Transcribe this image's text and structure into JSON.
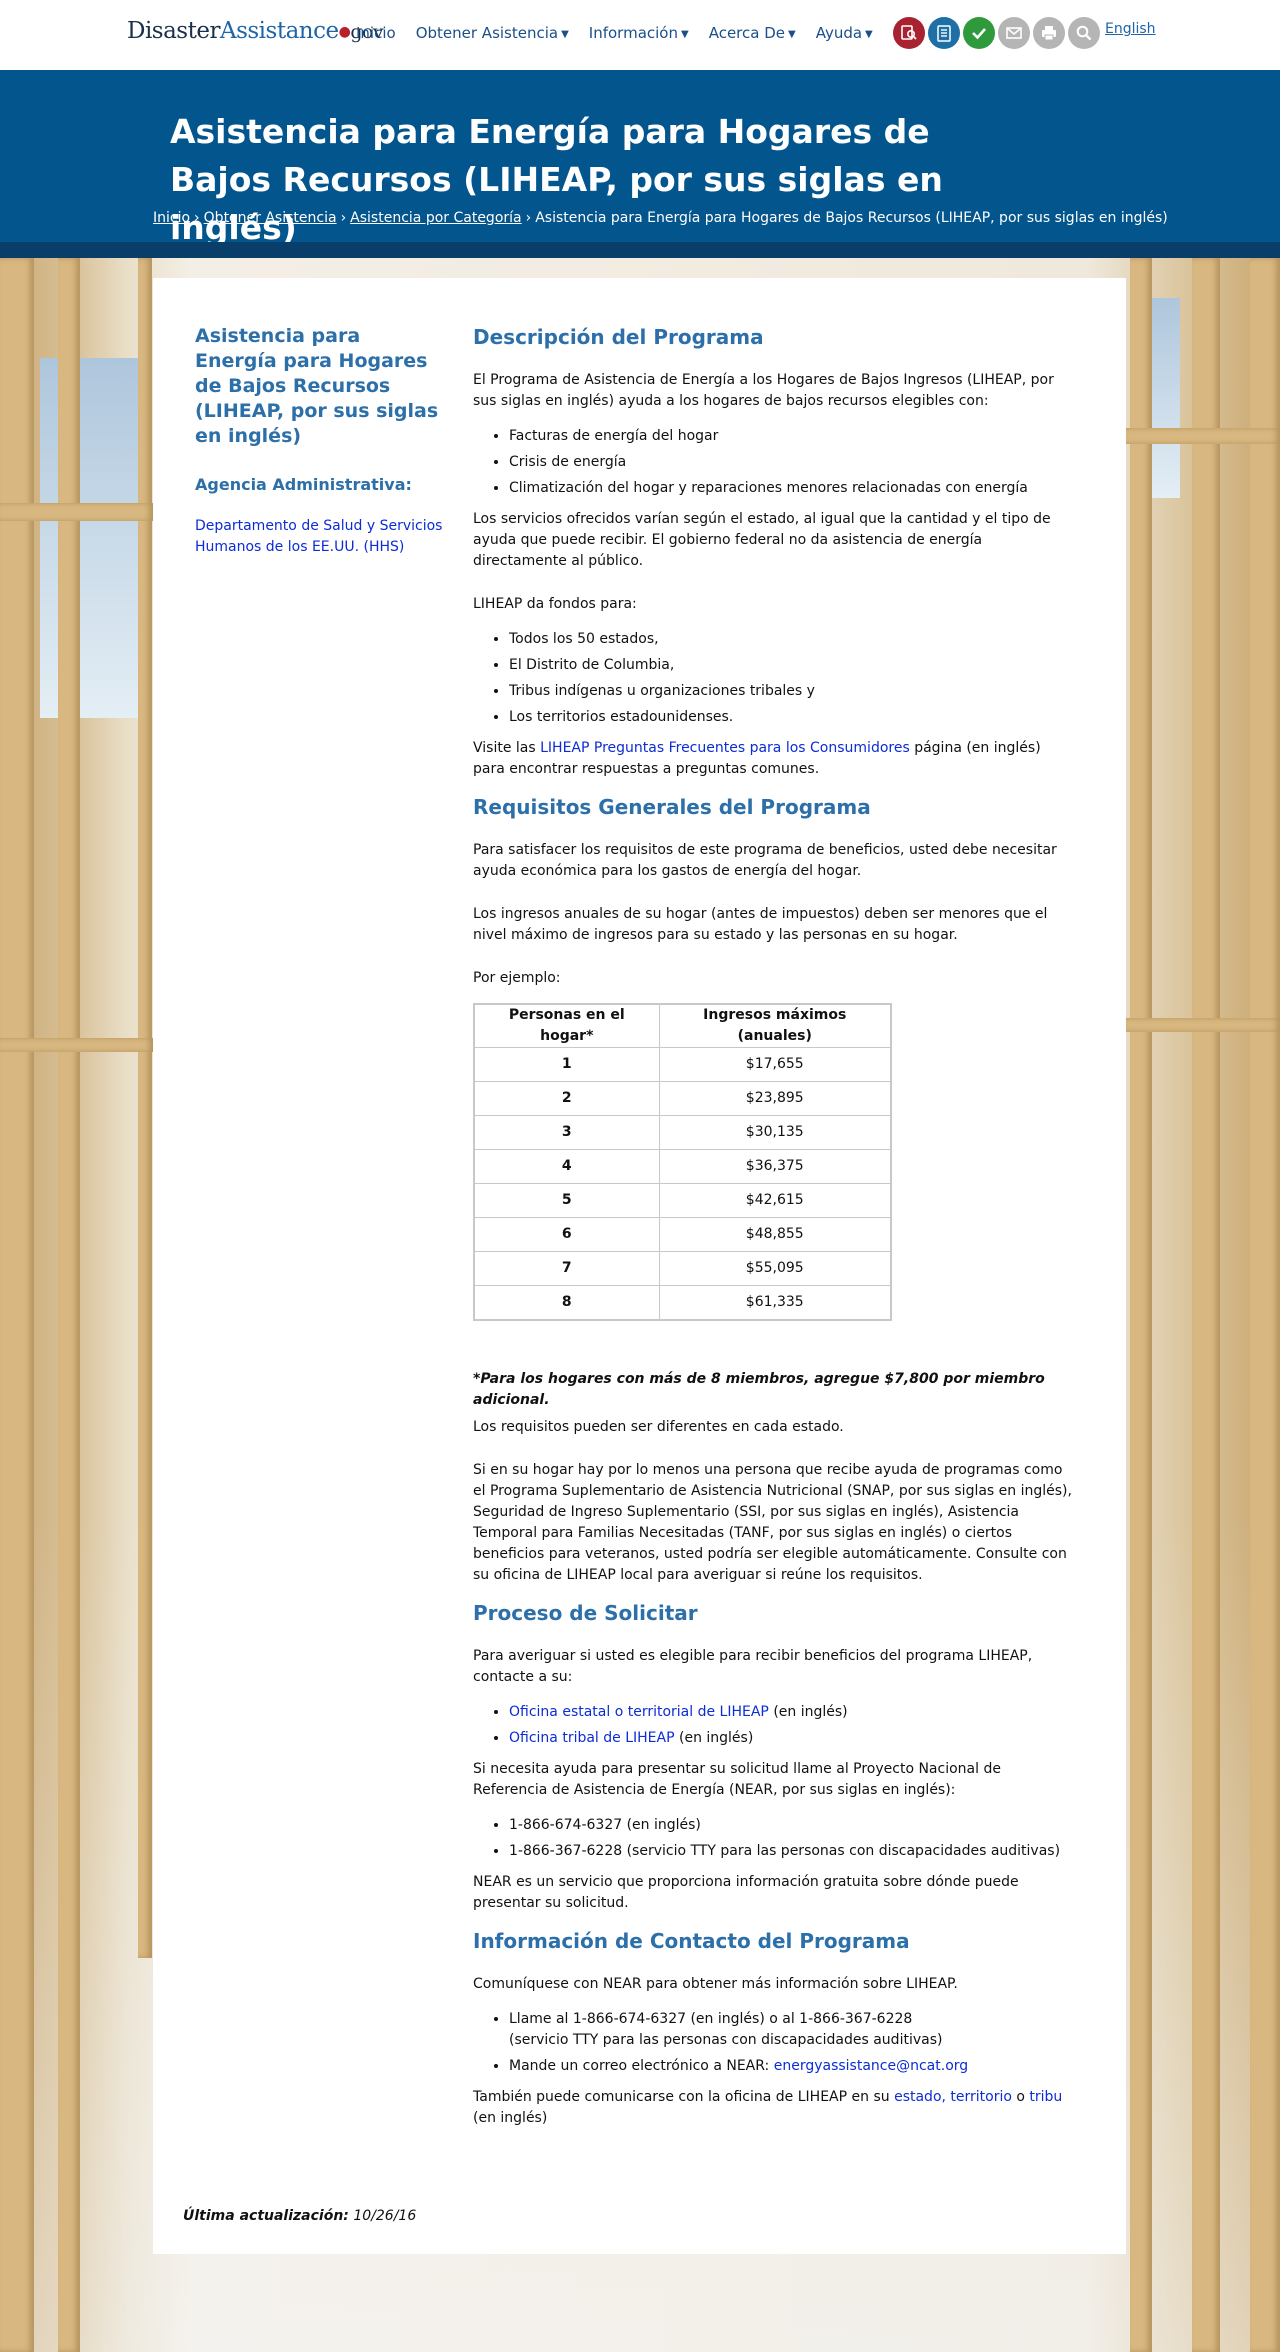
{
  "header": {
    "logo": {
      "brand_dark": "Disaster",
      "brand_blue": "Assistance",
      "dot": "●",
      "tld": "gov"
    },
    "nav": [
      {
        "label": "Inicio",
        "has_menu": false
      },
      {
        "label": "Obtener Asistencia",
        "has_menu": true
      },
      {
        "label": "Información",
        "has_menu": true
      },
      {
        "label": "Acerca De",
        "has_menu": true
      },
      {
        "label": "Ayuda",
        "has_menu": true
      }
    ],
    "tools": [
      {
        "icon": "search-document-icon",
        "color": "#a8232f"
      },
      {
        "icon": "checklist-icon",
        "color": "#1d6fa5"
      },
      {
        "icon": "checkmark-icon",
        "color": "#2f9a3c"
      },
      {
        "icon": "email-icon",
        "color": "#b5b5b5"
      },
      {
        "icon": "print-icon",
        "color": "#b5b5b5"
      },
      {
        "icon": "magnifier-icon",
        "color": "#b5b5b5"
      }
    ],
    "language_link": "English"
  },
  "banner": {
    "title": "Asistencia para Energía para Hogares de Bajos Recursos (LIHEAP, por sus siglas en inglés)",
    "breadcrumb": {
      "items": [
        "Inicio",
        "Obtener Asistencia",
        "Asistencia por Categoría"
      ],
      "separator": "›",
      "current": "Asistencia para Energía para Hogares de Bajos Recursos (LIHEAP, por sus siglas en inglés)"
    },
    "color": "#03558d"
  },
  "sidebar": {
    "title": "Asistencia para Energía para Hogares de Bajos Recursos (LIHEAP, por sus siglas en inglés)",
    "agency_label": "Agencia Administrativa:",
    "agency_link": "Departamento de Salud y Servicios Humanos de los EE.UU. (HHS)"
  },
  "main": {
    "description": {
      "heading": "Descripción del Programa",
      "intro": "El Programa de Asistencia de Energía a los Hogares de Bajos Ingresos (LIHEAP, por sus siglas en inglés) ayuda a los hogares de bajos recursos elegibles con:",
      "items": [
        "Facturas de energía del hogar",
        "Crisis de energía",
        "Climatización del hogar y reparaciones menores relacionadas con energía"
      ],
      "services": "Los servicios ofrecidos varían según el estado, al igual que la cantidad y el tipo de ayuda que puede recibir. El gobierno federal no da asistencia de energía directamente al público.",
      "funds_label": "LIHEAP da fondos para:",
      "funds": [
        "Todos los 50 estados,",
        "El Distrito de Columbia,",
        "Tribus indígenas u organizaciones tribales y",
        "Los territorios estadounidenses."
      ],
      "faq_prefix": "Visite las ",
      "faq_link": "LIHEAP Preguntas Frecuentes para los Consumidores",
      "faq_suffix": " página (en inglés) para encontrar respuestas a preguntas comunes."
    },
    "requirements": {
      "heading": "Requisitos Generales del Programa",
      "p1": "Para satisfacer los requisitos de este programa de beneficios, usted debe necesitar ayuda económica para los gastos de energía del hogar.",
      "p2": "Los ingresos anuales de su hogar (antes de impuestos) deben ser menores que el nivel máximo de ingresos para su estado y las personas en su hogar.",
      "example_label": "Por ejemplo:",
      "table": {
        "headers": [
          "Personas en el hogar*",
          "Ingresos máximos (anuales)"
        ],
        "rows": [
          [
            "1",
            "$17,655"
          ],
          [
            "2",
            "$23,895"
          ],
          [
            "3",
            "$30,135"
          ],
          [
            "4",
            "$36,375"
          ],
          [
            "5",
            "$42,615"
          ],
          [
            "6",
            "$48,855"
          ],
          [
            "7",
            "$55,095"
          ],
          [
            "8",
            "$61,335"
          ]
        ]
      },
      "footnote": "*Para los hogares con más de 8 miembros, agregue $7,800 por miembro adicional.",
      "differ": "Los requisitos pueden ser diferentes en cada estado.",
      "auto": "Si en su hogar hay por lo menos una persona que recibe ayuda de programas como el Programa Suplementario de Asistencia Nutricional (SNAP, por sus siglas en inglés), Seguridad de Ingreso Suplementario (SSI, por sus siglas en inglés), Asistencia Temporal para Familias Necesitadas (TANF, por sus siglas en inglés) o ciertos beneficios para veteranos, usted podría ser elegible automáticamente. Consulte con su oficina de LIHEAP local para averiguar si reúne los requisitos."
    },
    "apply": {
      "heading": "Proceso de Solicitar",
      "intro": "Para averiguar si usted es elegible para recibir beneficios del programa LIHEAP, contacte a su:",
      "offices": [
        {
          "link": "Oficina estatal o territorial de LIHEAP",
          "suffix": " (en inglés)"
        },
        {
          "link": "Oficina tribal de LIHEAP",
          "suffix": " (en inglés)"
        }
      ],
      "near_intro": "Si necesita ayuda para presentar su solicitud llame al Proyecto Nacional de Referencia de Asistencia de Energía (NEAR, por sus siglas en inglés):",
      "phones": [
        "1-866-674-6327 (en inglés)",
        "1-866-367-6228 (servicio TTY para las personas con discapacidades auditivas)"
      ],
      "near_note": "NEAR es un servicio que proporciona información gratuita sobre dónde puede presentar su solicitud."
    },
    "contact": {
      "heading": "Información de Contacto del Programa",
      "intro": "Comuníquese con NEAR para obtener más información sobre LIHEAP.",
      "call": "Llame al 1-866-674-6327 (en inglés) o al 1-866-367-6228",
      "call_line2": "(servicio TTY para las personas con discapacidades auditivas)",
      "email_prefix": "Mande un correo electrónico a NEAR: ",
      "email": "energyassistance@ncat.org",
      "office_prefix": "También puede comunicarse con la oficina de LIHEAP en su ",
      "office_link1": "estado, territorio",
      "office_mid": " o ",
      "office_link2": "tribu",
      "office_suffix": "(en inglés)"
    }
  },
  "footer": {
    "updated_label": "Última actualización:",
    "updated_value": "10/26/16"
  }
}
